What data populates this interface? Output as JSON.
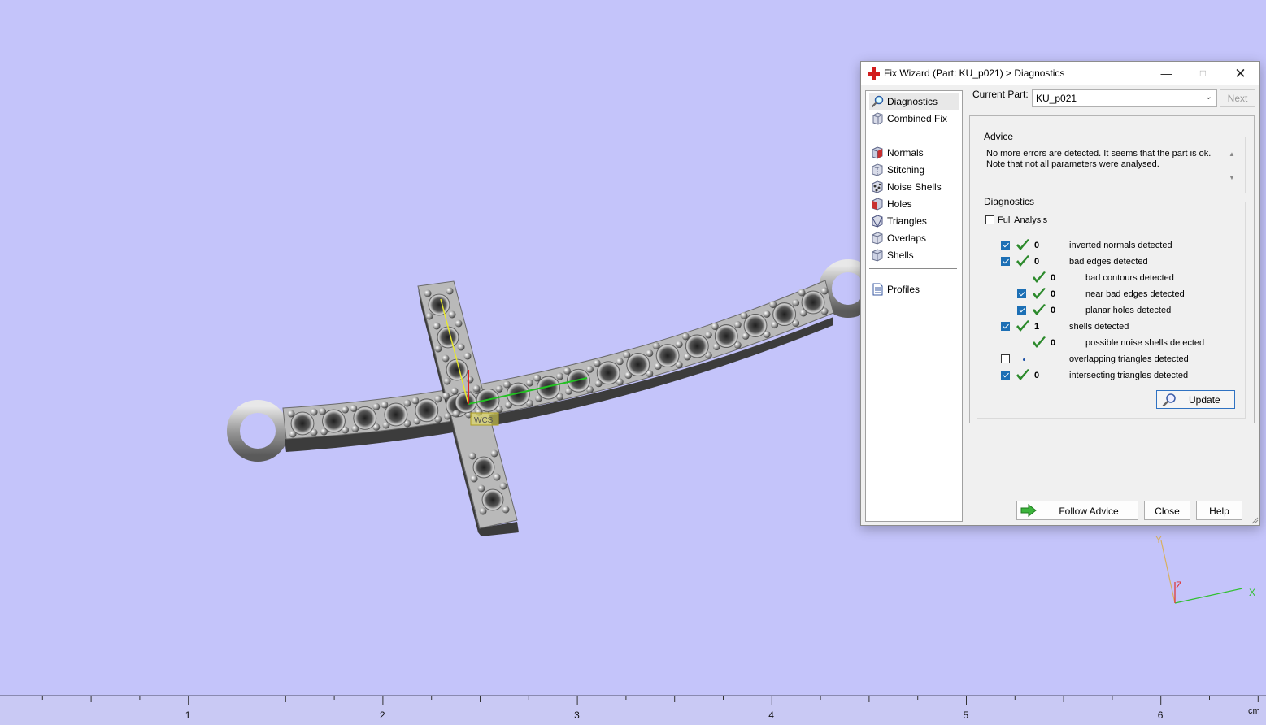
{
  "dialog": {
    "title": "Fix Wizard (Part: KU_p021) > Diagnostics",
    "nav_items": [
      {
        "label": "Diagnostics",
        "icon": "magnifier-icon",
        "selected": true
      },
      {
        "label": "Combined Fix",
        "icon": "cube-icon"
      },
      {
        "label": "Normals",
        "icon": "normals-cube-icon"
      },
      {
        "label": "Stitching",
        "icon": "stitching-cube-icon"
      },
      {
        "label": "Noise Shells",
        "icon": "noise-shells-icon"
      },
      {
        "label": "Holes",
        "icon": "holes-cube-icon"
      },
      {
        "label": "Triangles",
        "icon": "triangles-icon"
      },
      {
        "label": "Overlaps",
        "icon": "overlaps-icon"
      },
      {
        "label": "Shells",
        "icon": "shells-icon"
      },
      {
        "label": "Profiles",
        "icon": "document-icon"
      }
    ],
    "current_part_label": "Current Part:",
    "current_part_value": "KU_p021",
    "next_label": "Next",
    "advice": {
      "title": "Advice",
      "text": "No more errors are detected. It seems that the part is ok. Note that not all parameters were analysed."
    },
    "diagnostics": {
      "title": "Diagnostics",
      "full_analysis_label": "Full Analysis",
      "full_analysis_checked": false,
      "rows": [
        {
          "checked": true,
          "has_checkbox": true,
          "status": "ok",
          "value": "0",
          "label": "inverted normals detected",
          "indent": 0
        },
        {
          "checked": true,
          "has_checkbox": true,
          "status": "ok",
          "value": "0",
          "label": "bad edges detected",
          "indent": 0
        },
        {
          "checked": false,
          "has_checkbox": false,
          "status": "ok",
          "value": "0",
          "label": "bad contours detected",
          "indent": 1
        },
        {
          "checked": true,
          "has_checkbox": true,
          "status": "ok",
          "value": "0",
          "label": "near bad edges detected",
          "indent": 1
        },
        {
          "checked": true,
          "has_checkbox": true,
          "status": "ok",
          "value": "0",
          "label": "planar holes detected",
          "indent": 1
        },
        {
          "checked": true,
          "has_checkbox": true,
          "status": "ok",
          "value": "1",
          "label": "shells detected",
          "indent": 0
        },
        {
          "checked": false,
          "has_checkbox": false,
          "status": "ok",
          "value": "0",
          "label": "possible noise shells detected",
          "indent": 1
        },
        {
          "checked": false,
          "has_checkbox": true,
          "status": "none",
          "value": "",
          "label": "overlapping triangles detected",
          "indent": 0
        },
        {
          "checked": true,
          "has_checkbox": true,
          "status": "ok",
          "value": "0",
          "label": "intersecting triangles detected",
          "indent": 0
        }
      ],
      "update_label": "Update"
    },
    "buttons": {
      "follow_advice": "Follow Advice",
      "close": "Close",
      "help": "Help"
    }
  },
  "viewport": {
    "model_label": "WCS",
    "axis_labels": {
      "x": "X",
      "y": "Y",
      "z": "Z"
    }
  },
  "ruler": {
    "labels": [
      "1",
      "2",
      "3",
      "4",
      "5",
      "6"
    ],
    "unit": "cm"
  },
  "colors": {
    "background": "#c4c4fa",
    "check_green": "#2c8a2c",
    "checkbox_blue": "#1c6fb5"
  }
}
